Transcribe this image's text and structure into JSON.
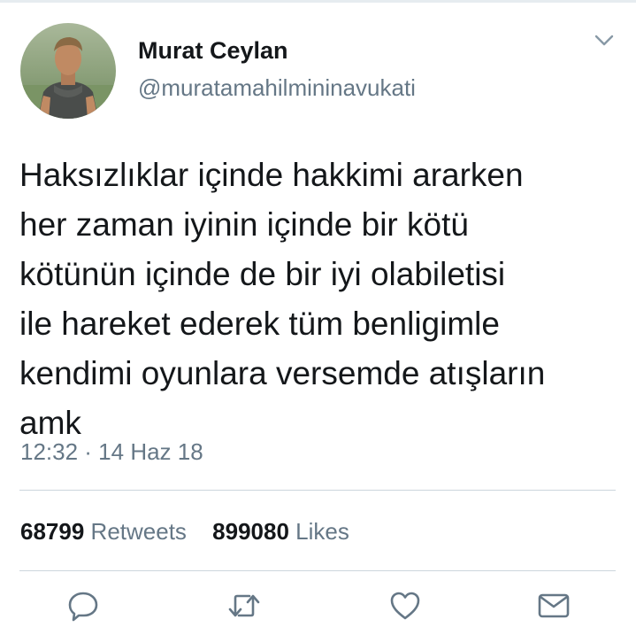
{
  "tweet": {
    "author": {
      "name": "Murat Ceylan",
      "handle": "@muratamahilmininavukati"
    },
    "text_lines": [
      "Haksızlıklar içinde hakkimi ararken",
      "her zaman iyinin içinde bir kötü",
      "kötünün içinde de bir iyi olabiletisi",
      "ile hareket ederek tüm benligimle",
      "kendimi oyunlara versemde atışların",
      "amk"
    ],
    "timestamp": "12:32 · 14 Haz 18",
    "stats": {
      "retweets_count": "68799",
      "retweets_label": "Retweets",
      "likes_count": "899080",
      "likes_label": "Likes"
    }
  },
  "icons": {
    "caret": "chevron-down-icon",
    "reply": "reply-icon",
    "retweet": "retweet-icon",
    "like": "heart-icon",
    "dm": "envelope-icon"
  },
  "colors": {
    "text_primary": "#14171a",
    "text_secondary": "#657786",
    "divider": "#ccd6dd",
    "icon": "#657786"
  }
}
